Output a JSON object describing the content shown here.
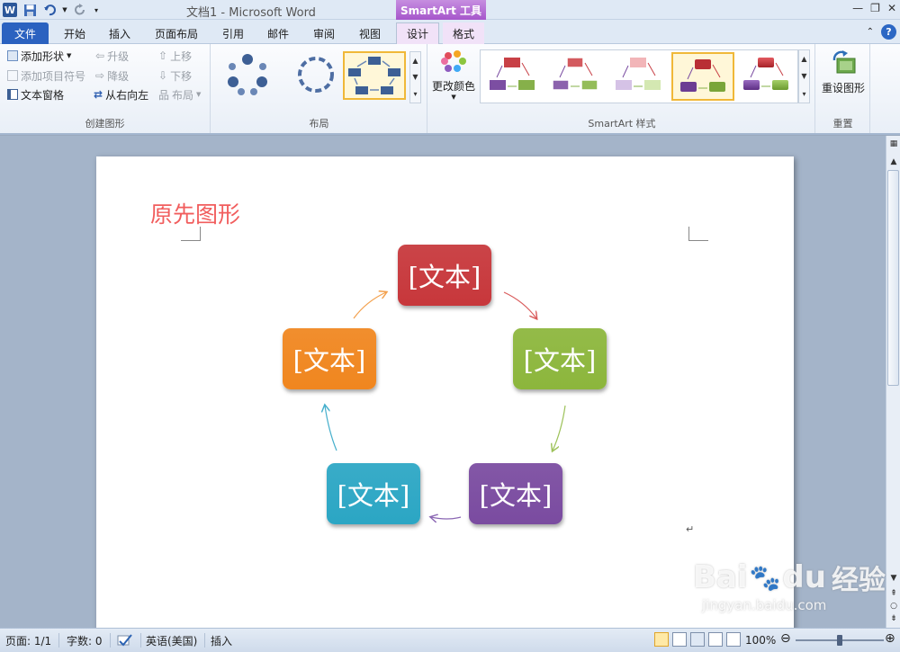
{
  "window": {
    "title": "文档1 - Microsoft Word",
    "context_tools_label": "SmartArt 工具",
    "app_icon_letter": "W"
  },
  "tabs": [
    {
      "label": "文件",
      "kind": "file"
    },
    {
      "label": "开始"
    },
    {
      "label": "插入"
    },
    {
      "label": "页面布局"
    },
    {
      "label": "引用"
    },
    {
      "label": "邮件"
    },
    {
      "label": "审阅"
    },
    {
      "label": "视图"
    },
    {
      "label": "设计",
      "active": true,
      "contextual": true
    },
    {
      "label": "格式",
      "contextual": true
    }
  ],
  "ribbon": {
    "create_graphic": {
      "label": "创建图形",
      "add_shape": "添加形状",
      "add_bullet": "添加项目符号",
      "text_pane": "文本窗格",
      "promote": "升级",
      "demote": "降级",
      "right_to_left": "从右向左",
      "move_up": "上移",
      "move_down": "下移",
      "layout": "布局"
    },
    "layouts": {
      "label": "布局"
    },
    "smartart_styles": {
      "label": "SmartArt 样式",
      "change_colors": "更改颜色"
    },
    "reset": {
      "label": "重置",
      "reset_graphic": "重设图形"
    }
  },
  "document": {
    "heading": "原先图形",
    "nodes": [
      {
        "text": "[文本]",
        "color": "#c7373b"
      },
      {
        "text": "[文本]",
        "color": "#8cb63c"
      },
      {
        "text": "[文本]",
        "color": "#7a4ba0"
      },
      {
        "text": "[文本]",
        "color": "#2ba6c4"
      },
      {
        "text": "[文本]",
        "color": "#f0861f"
      }
    ],
    "paragraph_mark": "↵"
  },
  "statusbar": {
    "page": "页面: 1/1",
    "words": "字数: 0",
    "language": "英语(美国)",
    "mode": "插入",
    "zoom": "100%"
  },
  "watermark": {
    "brand": "Bai",
    "brand2": "du",
    "product": "经验",
    "url": "jingyan.baidu.com"
  }
}
